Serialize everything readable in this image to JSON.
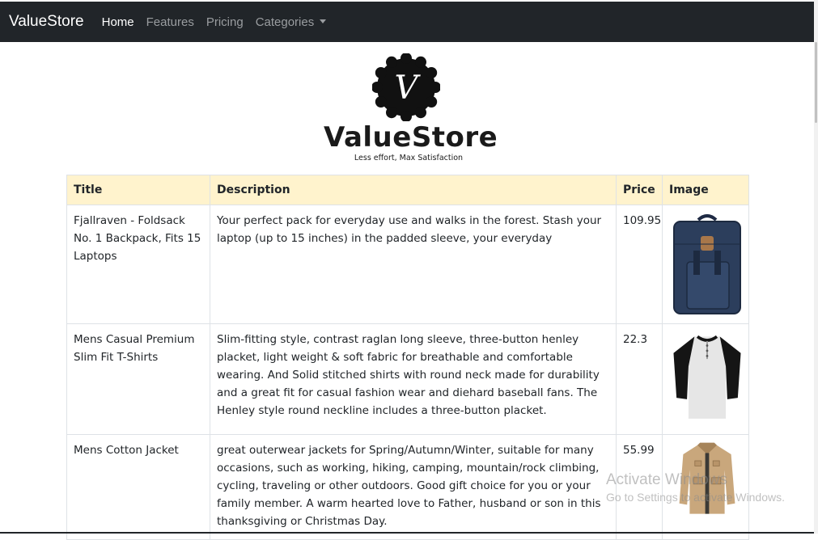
{
  "navbar": {
    "brand": "ValueStore",
    "links": [
      {
        "label": "Home",
        "active": true
      },
      {
        "label": "Features",
        "active": false
      },
      {
        "label": "Pricing",
        "active": false
      },
      {
        "label": "Categories",
        "active": false,
        "dropdown": true
      }
    ]
  },
  "logo": {
    "monogram": "V",
    "name": "ValueStore",
    "tagline": "Less effort, Max Satisfaction"
  },
  "table": {
    "header_bg": "#fff3cd",
    "headers": [
      "Title",
      "Description",
      "Price",
      "Image"
    ],
    "rows": [
      {
        "title": "Fjallraven - Foldsack No. 1 Backpack, Fits 15 Laptops",
        "description": "Your perfect pack for everyday use and walks in the forest. Stash your laptop (up to 15 inches) in the padded sleeve, your everyday",
        "price": "109.95",
        "image": "backpack-image"
      },
      {
        "title": "Mens Casual Premium Slim Fit T-Shirts",
        "description": "Slim-fitting style, contrast raglan long sleeve, three-button henley placket, light weight & soft fabric for breathable and comfortable wearing. And Solid stitched shirts with round neck made for durability and a great fit for casual fashion wear and diehard baseball fans. The Henley style round neckline includes a three-button placket.",
        "price": "22.3",
        "image": "tshirt-image"
      },
      {
        "title": "Mens Cotton Jacket",
        "description": "great outerwear jackets for Spring/Autumn/Winter, suitable for many occasions, such as working, hiking, camping, mountain/rock climbing, cycling, traveling or other outdoors. Good gift choice for you or your family member. A warm hearted love to Father, husband or son in this thanksgiving or Christmas Day.",
        "price": "55.99",
        "image": "jacket-image"
      }
    ]
  },
  "watermark": {
    "line1": "Activate Windows",
    "line2": "Go to Settings to activate Windows."
  }
}
